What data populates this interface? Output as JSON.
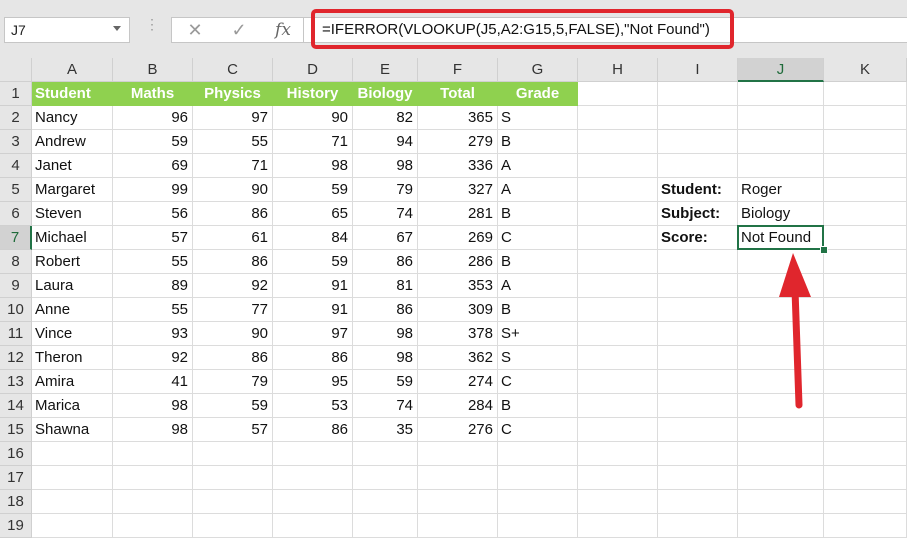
{
  "name_box": "J7",
  "formula": "=IFERROR(VLOOKUP(J5,A2:G15,5,FALSE),\"Not Found\")",
  "fx_icons": {
    "cancel": "✕",
    "enter": "✓",
    "fx": "fx"
  },
  "columns": [
    "A",
    "B",
    "C",
    "D",
    "E",
    "F",
    "G",
    "H",
    "I",
    "J",
    "K"
  ],
  "rows": [
    "1",
    "2",
    "3",
    "4",
    "5",
    "6",
    "7",
    "8",
    "9",
    "10",
    "11",
    "12",
    "13",
    "14",
    "15",
    "16",
    "17",
    "18",
    "19"
  ],
  "table": {
    "headers": [
      "Student",
      "Maths",
      "Physics",
      "History",
      "Biology",
      "Total",
      "Grade"
    ],
    "rows": [
      [
        "Nancy",
        "96",
        "97",
        "90",
        "82",
        "365",
        "S"
      ],
      [
        "Andrew",
        "59",
        "55",
        "71",
        "94",
        "279",
        "B"
      ],
      [
        "Janet",
        "69",
        "71",
        "98",
        "98",
        "336",
        "A"
      ],
      [
        "Margaret",
        "99",
        "90",
        "59",
        "79",
        "327",
        "A"
      ],
      [
        "Steven",
        "56",
        "86",
        "65",
        "74",
        "281",
        "B"
      ],
      [
        "Michael",
        "57",
        "61",
        "84",
        "67",
        "269",
        "C"
      ],
      [
        "Robert",
        "55",
        "86",
        "59",
        "86",
        "286",
        "B"
      ],
      [
        "Laura",
        "89",
        "92",
        "91",
        "81",
        "353",
        "A"
      ],
      [
        "Anne",
        "55",
        "77",
        "91",
        "86",
        "309",
        "B"
      ],
      [
        "Vince",
        "93",
        "90",
        "97",
        "98",
        "378",
        "S+"
      ],
      [
        "Theron",
        "92",
        "86",
        "86",
        "98",
        "362",
        "S"
      ],
      [
        "Amira",
        "41",
        "79",
        "95",
        "59",
        "274",
        "C"
      ],
      [
        "Marica",
        "98",
        "59",
        "53",
        "74",
        "284",
        "B"
      ],
      [
        "Shawna",
        "98",
        "57",
        "86",
        "35",
        "276",
        "C"
      ]
    ]
  },
  "lookup": {
    "labels": [
      "Student:",
      "Subject:",
      "Score:"
    ],
    "values": [
      "Roger",
      "Biology",
      "Not Found"
    ]
  },
  "colors": {
    "header_fill": "#8fd14f",
    "selection": "#217346",
    "highlight": "#e0262d"
  }
}
